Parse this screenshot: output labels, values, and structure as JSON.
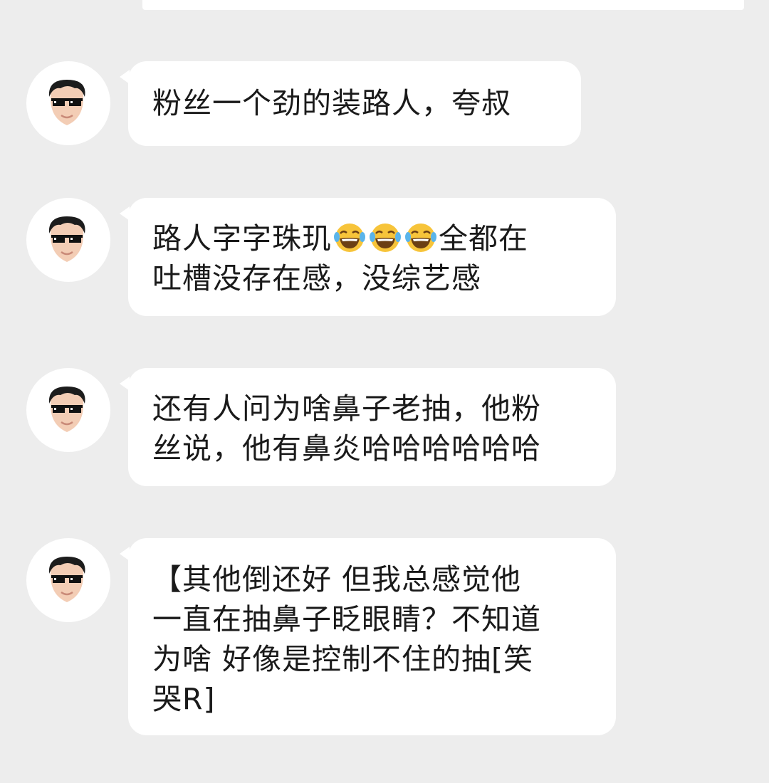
{
  "messages": [
    {
      "text": "粉丝一个劲的装路人，夸叔"
    },
    {
      "text_before": "路人字字珠玑",
      "emoji_count": 3,
      "emoji": "laughing-crying-emoji",
      "text_after": "全都在\n吐槽没存在感，没综艺感"
    },
    {
      "text": "还有人问为啥鼻子老抽，他粉\n丝说，他有鼻炎哈哈哈哈哈哈"
    },
    {
      "text": "【其他倒还好 但我总感觉他\n一直在抽鼻子眨眼睛？不知道\n为啥 好像是控制不住的抽[笑\n哭R]"
    }
  ],
  "colors": {
    "background": "#ededed",
    "bubble": "#ffffff",
    "text": "#1a1a1a"
  },
  "avatar_icon": "sunglasses-boy-avatar"
}
